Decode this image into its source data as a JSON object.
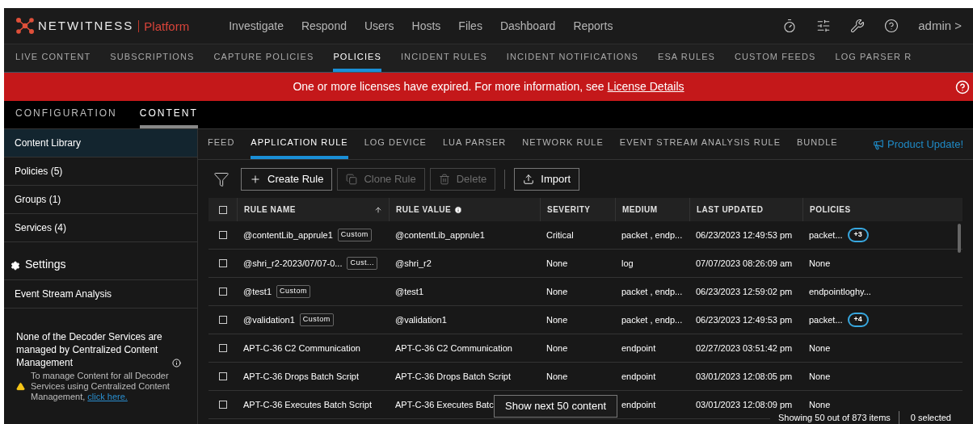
{
  "brand": {
    "name": "NETWITNESS",
    "product": "Platform"
  },
  "main_nav": [
    {
      "label": "Investigate",
      "selected": false
    },
    {
      "label": "Respond",
      "selected": false
    },
    {
      "label": "Users",
      "selected": false
    },
    {
      "label": "Hosts",
      "selected": false
    },
    {
      "label": "Files",
      "selected": false
    },
    {
      "label": "Dashboard",
      "selected": false
    },
    {
      "label": "Reports",
      "selected": false
    }
  ],
  "user": {
    "name": "admin",
    "caret": ">"
  },
  "config_nav": [
    {
      "label": "LIVE CONTENT",
      "selected": false
    },
    {
      "label": "SUBSCRIPTIONS",
      "selected": false
    },
    {
      "label": "CAPTURE POLICIES",
      "selected": false
    },
    {
      "label": "POLICIES",
      "selected": true
    },
    {
      "label": "INCIDENT RULES",
      "selected": false
    },
    {
      "label": "INCIDENT NOTIFICATIONS",
      "selected": false
    },
    {
      "label": "ESA RULES",
      "selected": false
    },
    {
      "label": "CUSTOM FEEDS",
      "selected": false
    },
    {
      "label": "LOG PARSER R",
      "selected": false
    }
  ],
  "banner": {
    "text": "One or more licenses have expired. For more information, see",
    "link": "License Details"
  },
  "section_tabs": [
    {
      "label": "CONFIGURATION",
      "selected": false
    },
    {
      "label": "CONTENT",
      "selected": true
    }
  ],
  "sidebar": {
    "items": [
      {
        "label": "Content Library",
        "selected": true
      },
      {
        "label": "Policies (5)",
        "selected": false
      },
      {
        "label": "Groups (1)",
        "selected": false
      },
      {
        "label": "Services (4)",
        "selected": false
      }
    ],
    "settings_heading": "Settings",
    "settings_items": [
      {
        "label": "Event Stream Analysis",
        "selected": false
      }
    ],
    "notice_title": "None of the Decoder Services are managed by Centralized Content Management",
    "notice_text": "To manage Content for all Decoder Services using Centralized Content Management,",
    "notice_link": "click here."
  },
  "content_tabs": [
    {
      "label": "FEED",
      "selected": false
    },
    {
      "label": "APPLICATION RULE",
      "selected": true
    },
    {
      "label": "LOG DEVICE",
      "selected": false
    },
    {
      "label": "LUA PARSER",
      "selected": false
    },
    {
      "label": "NETWORK RULE",
      "selected": false
    },
    {
      "label": "EVENT STREAM ANALYSIS RULE",
      "selected": false
    },
    {
      "label": "BUNDLE",
      "selected": false
    }
  ],
  "product_update": "Product Update!",
  "toolbar": [
    {
      "label": "Create Rule",
      "kind": "create",
      "disabled": false
    },
    {
      "label": "Clone Rule",
      "kind": "clone",
      "disabled": true
    },
    {
      "label": "Delete",
      "kind": "delete",
      "disabled": true
    },
    {
      "label": "Import",
      "kind": "import",
      "disabled": false
    }
  ],
  "table": {
    "all_checked": false,
    "columns": [
      "RULE NAME",
      "RULE VALUE",
      "SEVERITY",
      "MEDIUM",
      "LAST UPDATED",
      "POLICIES"
    ],
    "rows": [
      {
        "checked": false,
        "name": "@contentLib_apprule1",
        "tag": "Custom",
        "value": "@contentLib_apprule1",
        "severity": "Critical",
        "medium": "packet , endp...",
        "updated": "06/23/2023 12:49:53 pm",
        "policies": "packet...",
        "policy_more": "+3"
      },
      {
        "checked": false,
        "name": "@shri_r2-2023/07/07-0...",
        "tag": "Cust...",
        "value": "@shri_r2",
        "severity": "None",
        "medium": "log",
        "updated": "07/07/2023 08:26:09 am",
        "policies": "None"
      },
      {
        "checked": false,
        "name": "@test1",
        "tag": "Custom",
        "value": "@test1",
        "severity": "None",
        "medium": "packet , endp...",
        "updated": "06/23/2023 12:59:02 pm",
        "policies": "endpointloghy..."
      },
      {
        "checked": false,
        "name": "@validation1",
        "tag": "Custom",
        "value": "@validation1",
        "severity": "None",
        "medium": "packet , endp...",
        "updated": "06/23/2023 12:49:53 pm",
        "policies": "packet...",
        "policy_more": "+4"
      },
      {
        "checked": false,
        "name": "APT-C-36 C2 Communication",
        "value": "APT-C-36 C2 Communication",
        "severity": "None",
        "medium": "endpoint",
        "updated": "02/27/2023 03:51:42 pm",
        "policies": "None"
      },
      {
        "checked": false,
        "name": "APT-C-36 Drops Batch Script",
        "value": "APT-C-36 Drops Batch Script",
        "severity": "None",
        "medium": "endpoint",
        "updated": "03/01/2023 12:08:05 pm",
        "policies": "None"
      },
      {
        "checked": false,
        "name": "APT-C-36 Executes Batch Script",
        "value": "APT-C-36 Executes Batc",
        "medium": "endpoint",
        "updated": "03/01/2023 12:08:09 pm",
        "policies": "None"
      }
    ]
  },
  "show_next": "Show next 50 content",
  "footer": {
    "count": "Showing 50 out of 873 items",
    "selected": "0 selected"
  }
}
